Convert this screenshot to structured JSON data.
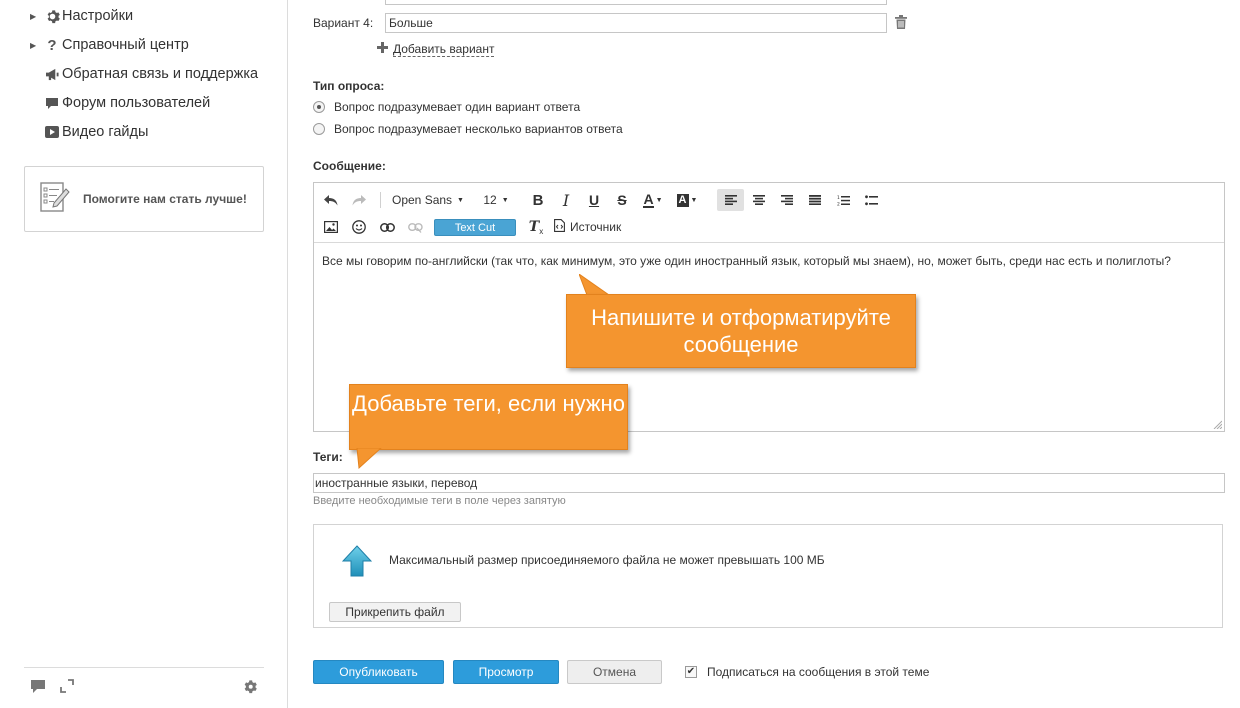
{
  "sidebar": {
    "items": [
      {
        "label": "Настройки",
        "icon": "gear-icon",
        "expandable": true
      },
      {
        "label": "Справочный центр",
        "icon": "question-icon",
        "expandable": true
      },
      {
        "label": "Обратная связь и поддержка",
        "icon": "megaphone-icon",
        "expandable": false
      },
      {
        "label": "Форум пользователей",
        "icon": "chat-bubble-icon",
        "expandable": false
      },
      {
        "label": "Видео гайды",
        "icon": "video-play-icon",
        "expandable": false
      }
    ],
    "help_box": {
      "label": "Помогите нам стать лучше!",
      "icon": "feedback-form-icon"
    },
    "footer_icons": [
      "chat-icon",
      "fullscreen-icon",
      "settings-gear-icon"
    ]
  },
  "poll": {
    "variant4": {
      "label": "Вариант 4:",
      "value": "Больше"
    },
    "add_variant": "Добавить вариант",
    "type_label": "Тип опроса:",
    "types": [
      {
        "label": "Вопрос подразумевает один вариант ответа",
        "checked": true
      },
      {
        "label": "Вопрос подразумевает несколько вариантов ответа",
        "checked": false
      }
    ]
  },
  "message": {
    "label": "Сообщение:",
    "toolbar": {
      "font": "Open Sans",
      "size": "12",
      "textcut": "Text Cut",
      "source": "Источник"
    },
    "text": "Все мы говорим по-английски (так что, как минимум, это уже один иностранный язык, который мы знаем), но, может быть, среди нас есть и полиглоты?"
  },
  "callouts": {
    "message": "Напишите и отформатируйте сообщение",
    "tags": "Добавьте теги, если нужно"
  },
  "tags": {
    "label": "Теги:",
    "value": "иностранные языки, перевод",
    "hint": "Введите необходимые теги в поле через запятую"
  },
  "upload": {
    "note": "Максимальный размер присоединяемого файла не может превышать 100 МБ",
    "attach_label": "Прикрепить файл"
  },
  "actions": {
    "publish": "Опубликовать",
    "preview": "Просмотр",
    "cancel": "Отмена",
    "subscribe": "Подписаться на сообщения в этой теме",
    "subscribe_checked": true
  },
  "colors": {
    "primary_button": "#2d9cdb",
    "callout": "#f4952f",
    "textcut": "#4aa4d4"
  }
}
